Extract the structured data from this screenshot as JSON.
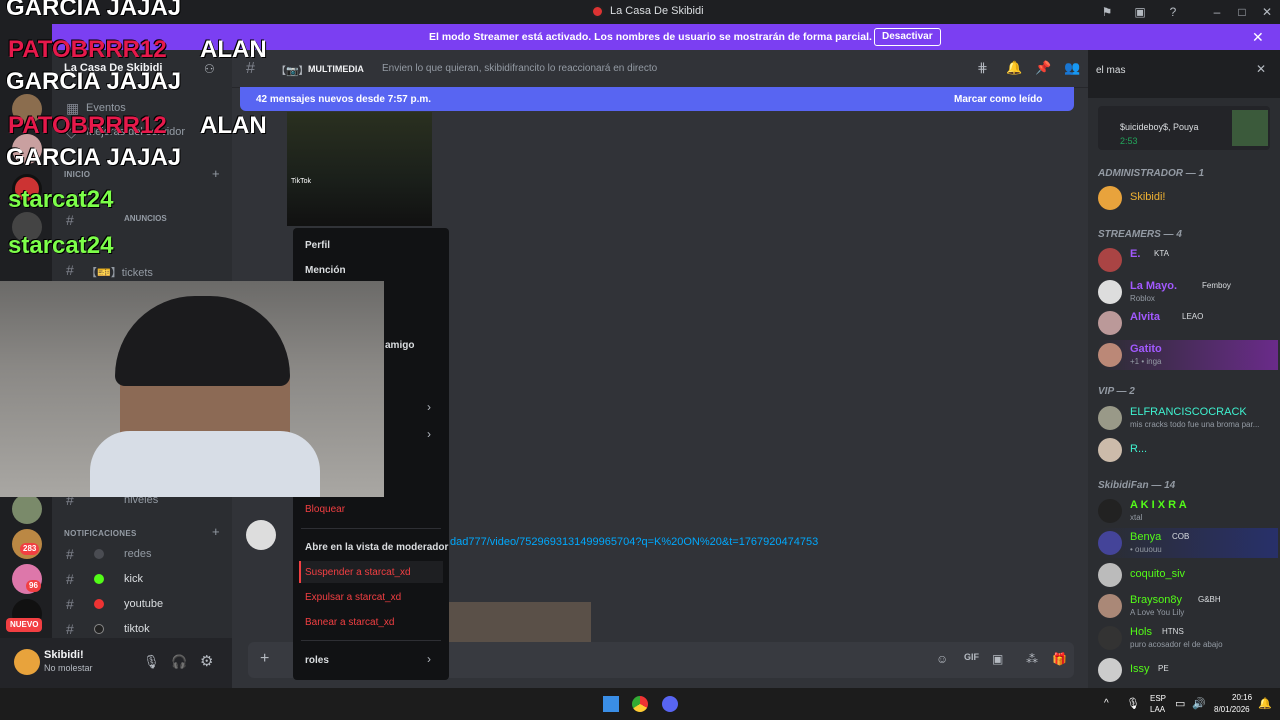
{
  "window": {
    "title": "La Casa De Skibidi"
  },
  "streamer_banner": {
    "message": "El modo Streamer está activado. Los nombres de usuario se mostrarán de forma parcial.",
    "button_label": "Desactivar"
  },
  "server": {
    "name": "La Casa De Skibidi"
  },
  "sidebar": {
    "events_label": "Eventos",
    "boosts_label": "Mejoras del servidor",
    "category_inicio": "INICIO",
    "announcements_label": "ANUNCIOS",
    "tickets_label": "【🎫】tickets",
    "niveles_label": "niveles",
    "category_notifications": "NOTIFICACIONES",
    "channels": [
      {
        "label": "redes"
      },
      {
        "label": "kick"
      },
      {
        "label": "youtube"
      },
      {
        "label": "tiktok"
      }
    ]
  },
  "guild_badges": {
    "badge1": "283",
    "badge2": "96",
    "nuevo": "NUEVO"
  },
  "user": {
    "name": "Skibidi!",
    "status": "No molestar"
  },
  "channel": {
    "name": "MULTIMEDIA",
    "topic": "Envien lo que quieran, skibidifrancito lo reaccionará en directo"
  },
  "new_messages": {
    "text": "42 mensajes nuevos desde 7:57 p.m.",
    "mark_read": "Marcar como leído"
  },
  "message": {
    "link_text": "dad777/video/7529693131499965704?q=K%20ON%20&t=1767920474753",
    "tiktok_label": "TikTok"
  },
  "search": {
    "value": "el mas"
  },
  "context_menu": {
    "items": [
      "Perfil",
      "Mención",
      "amigo",
      "Bloquear",
      "Abre en la vista de moderador",
      "Suspender a starcat_xd",
      "Expulsar a starcat_xd",
      "Banear a starcat_xd",
      "roles"
    ]
  },
  "members": {
    "now_playing": {
      "artist": "$uicideboy$, Pouya",
      "time": "2:53"
    },
    "categories": [
      {
        "label": "ADMINISTRADOR — 1"
      },
      {
        "label": "STREAMERS — 4"
      },
      {
        "label": "VIP — 2"
      },
      {
        "label": "SkibidiFan — 14"
      }
    ],
    "admin": [
      {
        "name": "Skibidi!",
        "color": "#f0b232"
      }
    ],
    "streamers": [
      {
        "name": "E.",
        "tag": "KTA",
        "sub": ""
      },
      {
        "name": "La Mayo.",
        "tag": "Femboy",
        "sub": "Roblox"
      },
      {
        "name": "Alvita",
        "tag": "LEAO",
        "sub": ""
      },
      {
        "name": "Gatito",
        "tag": "",
        "sub": "+1 • inga"
      }
    ],
    "vip": [
      {
        "name": "ELFRANCISCOCRACK",
        "sub": "mis cracks todo fue una broma par..."
      },
      {
        "name": "R...",
        "sub": ""
      }
    ],
    "fans": [
      {
        "name": "A K I X R A",
        "tag": "",
        "sub": "xtal"
      },
      {
        "name": "Benya",
        "tag": "COB",
        "sub": "• ouuouu"
      },
      {
        "name": "coquito_siv",
        "tag": "",
        "sub": ""
      },
      {
        "name": "Brayson8y",
        "tag": "G&BH",
        "sub": "A Love You Lily"
      },
      {
        "name": "Hols",
        "tag": "HTNS",
        "sub": "puro acosador el de abajo"
      },
      {
        "name": "Issy",
        "tag": "PE",
        "sub": ""
      }
    ]
  },
  "overlay": {
    "line1": "GARCIA JAJAJ",
    "line2a": "PATOBRRR12",
    "line2b": "ALAN",
    "line3": "GARCIA JAJAJ",
    "line4a": "PATOBRRR12",
    "line4b": "ALAN",
    "line5": "GARCIA JAJAJ",
    "line6": "starcat24",
    "line7": "starcat24"
  },
  "taskbar": {
    "lang1": "ESP",
    "lang2": "LAA",
    "time": "20:16",
    "date": "8/01/2026"
  }
}
